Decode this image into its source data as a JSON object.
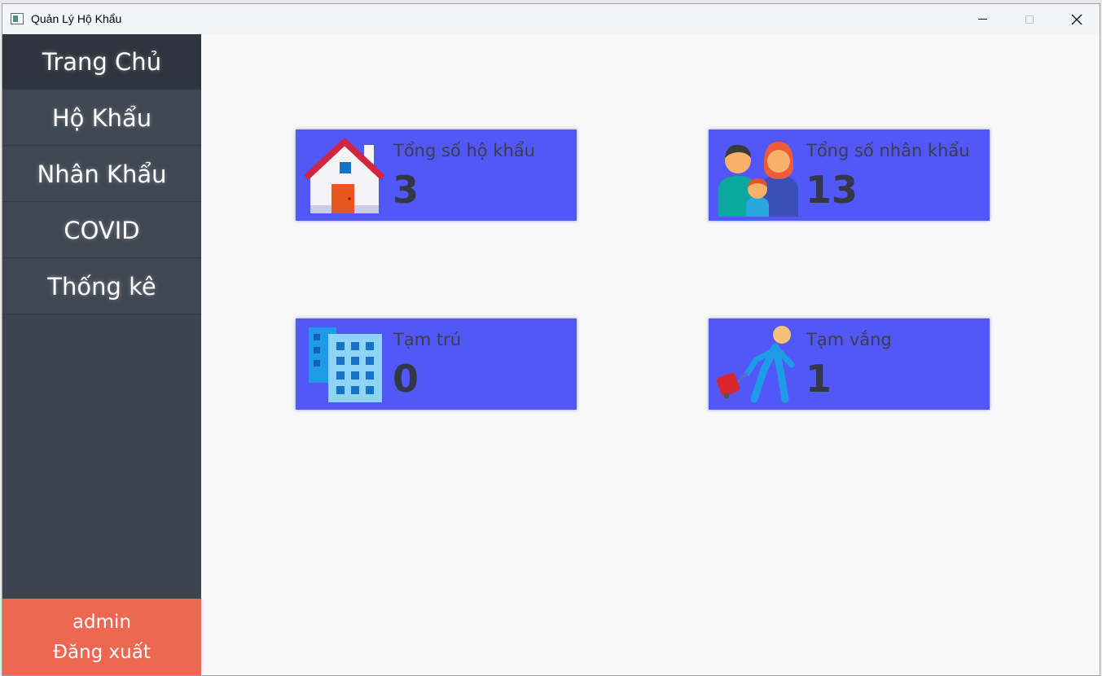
{
  "window": {
    "title": "Quản Lý Hộ Khẩu"
  },
  "sidebar": {
    "items": [
      {
        "label": "Trang Chủ",
        "active": true
      },
      {
        "label": "Hộ Khẩu"
      },
      {
        "label": "Nhân Khẩu"
      },
      {
        "label": "COVID"
      },
      {
        "label": "Thống kê"
      }
    ],
    "user": "admin",
    "logout_label": "Đăng xuất"
  },
  "dashboard": {
    "cards": [
      {
        "label": "Tổng số hộ khẩu",
        "value": "3",
        "icon": "house-icon"
      },
      {
        "label": "Tổng số nhân khẩu",
        "value": "13",
        "icon": "family-icon"
      },
      {
        "label": "Tạm trú",
        "value": "0",
        "icon": "building-icon"
      },
      {
        "label": "Tạm vắng",
        "value": "1",
        "icon": "traveler-icon"
      }
    ]
  },
  "colors": {
    "sidebar": "#3c4450",
    "sidebar_active": "#2f353e",
    "logout": "#ee6750",
    "card": "#5257f7",
    "content_bg": "#f8f8f8"
  }
}
